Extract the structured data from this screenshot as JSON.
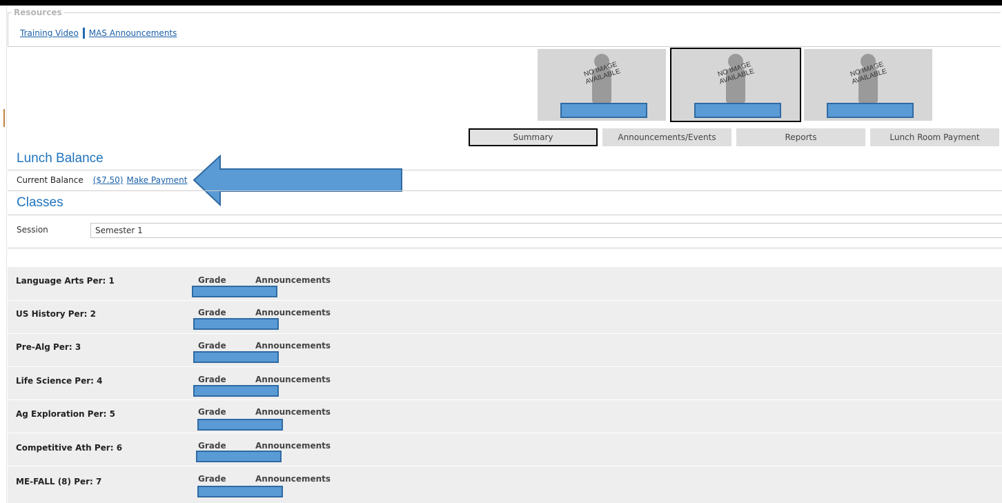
{
  "resources": {
    "legend": "Resources",
    "links": [
      "Training Video",
      "MAS Announcements"
    ]
  },
  "students": [
    {
      "no_image_line1": "NO IMAGE",
      "no_image_line2": "AVAILABLE",
      "selected": false
    },
    {
      "no_image_line1": "NO IMAGE",
      "no_image_line2": "AVAILABLE",
      "selected": true
    },
    {
      "no_image_line1": "NO IMAGE",
      "no_image_line2": "AVAILABLE",
      "selected": false
    }
  ],
  "tabs": [
    {
      "label": "Summary",
      "active": true
    },
    {
      "label": "Announcements/Events",
      "active": false
    },
    {
      "label": "Reports",
      "active": false
    },
    {
      "label": "Lunch Room Payment",
      "active": false
    }
  ],
  "lunch": {
    "title": "Lunch Balance",
    "current_label": "Current Balance",
    "amount": "($7.50)",
    "make_payment": "Make Payment"
  },
  "classes": {
    "title": "Classes",
    "session_label": "Session",
    "session_value": "Semester 1",
    "grade_header": "Grade",
    "announcements_header": "Announcements",
    "rows": [
      "Language Arts Per: 1",
      "US History Per: 2",
      "Pre-Alg Per: 3",
      "Life Science Per: 4",
      "Ag Exploration Per: 5",
      "Competitive Ath Per: 6",
      "ME-FALL (8) Per: 7"
    ]
  },
  "colors": {
    "accent_blue": "#1e73be",
    "redaction_blue": "#5b9bd5",
    "row_bg": "#eeeeee"
  }
}
